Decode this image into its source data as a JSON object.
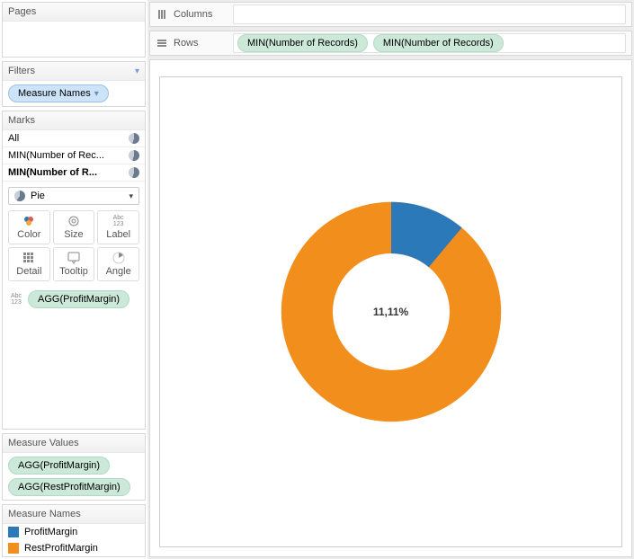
{
  "panels": {
    "pages": {
      "title": "Pages"
    },
    "filters": {
      "title": "Filters",
      "pill": "Measure Names"
    },
    "marks": {
      "title": "Marks",
      "items": [
        "All",
        "MIN(Number of Rec...",
        "MIN(Number of R..."
      ],
      "mark_type": "Pie",
      "buttons": {
        "color": "Color",
        "size": "Size",
        "label": "Label",
        "detail": "Detail",
        "tooltip": "Tooltip",
        "angle": "Angle"
      },
      "label_pill": "AGG(ProfitMargin)"
    },
    "measure_values": {
      "title": "Measure Values",
      "pills": [
        "AGG(ProfitMargin)",
        "AGG(RestProfitMargin)"
      ]
    },
    "measure_names": {
      "title": "Measure Names",
      "items": [
        {
          "label": "ProfitMargin",
          "color": "#2b79b9"
        },
        {
          "label": "RestProfitMargin",
          "color": "#f28e1c"
        }
      ]
    }
  },
  "shelves": {
    "columns": {
      "label": "Columns"
    },
    "rows": {
      "label": "Rows",
      "pills": [
        "MIN(Number of Records)",
        "MIN(Number of Records)"
      ]
    }
  },
  "chart_data": {
    "type": "pie",
    "donut": true,
    "center_label": "11,11%",
    "series": [
      {
        "name": "ProfitMargin",
        "value": 11.11,
        "color": "#2b79b9"
      },
      {
        "name": "RestProfitMargin",
        "value": 88.89,
        "color": "#f28e1c"
      }
    ]
  }
}
